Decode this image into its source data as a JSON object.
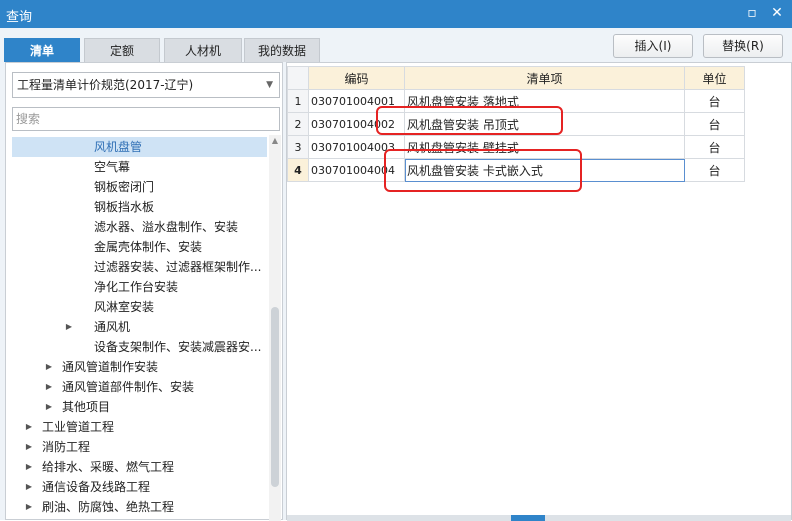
{
  "window": {
    "title": "查询",
    "restore_icon": "window-restore-icon",
    "close_icon": "close-icon"
  },
  "tabs": [
    {
      "label": "清单",
      "active": true
    },
    {
      "label": "定额",
      "active": false
    },
    {
      "label": "人材机",
      "active": false
    },
    {
      "label": "我的数据",
      "active": false
    }
  ],
  "buttons": {
    "insert": "插入(I)",
    "replace": "替换(R)"
  },
  "left": {
    "spec_select": "工程量清单计价规范(2017-辽宁)",
    "search_placeholder": "搜索",
    "tree": [
      {
        "label": "风机盘管",
        "selected": true,
        "expandable": false,
        "level": 3
      },
      {
        "label": "空气幕",
        "selected": false,
        "expandable": false,
        "level": 3
      },
      {
        "label": "钢板密闭门",
        "selected": false,
        "expandable": false,
        "level": 3
      },
      {
        "label": "钢板挡水板",
        "selected": false,
        "expandable": false,
        "level": 3
      },
      {
        "label": "滤水器、溢水盘制作、安装",
        "selected": false,
        "expandable": false,
        "level": 3
      },
      {
        "label": "金属壳体制作、安装",
        "selected": false,
        "expandable": false,
        "level": 3
      },
      {
        "label": "过滤器安装、过滤器框架制作...",
        "selected": false,
        "expandable": false,
        "level": 3
      },
      {
        "label": "净化工作台安装",
        "selected": false,
        "expandable": false,
        "level": 3
      },
      {
        "label": "风淋室安装",
        "selected": false,
        "expandable": false,
        "level": 3
      },
      {
        "label": "通风机",
        "selected": false,
        "expandable": true,
        "level": 3
      },
      {
        "label": "设备支架制作、安装减震器安...",
        "selected": false,
        "expandable": false,
        "level": 3
      },
      {
        "label": "通风管道制作安装",
        "selected": false,
        "expandable": true,
        "level": 2
      },
      {
        "label": "通风管道部件制作、安装",
        "selected": false,
        "expandable": true,
        "level": 2
      },
      {
        "label": "其他项目",
        "selected": false,
        "expandable": true,
        "level": 2
      },
      {
        "label": "工业管道工程",
        "selected": false,
        "expandable": true,
        "level": 1
      },
      {
        "label": "消防工程",
        "selected": false,
        "expandable": true,
        "level": 1
      },
      {
        "label": "给排水、采暖、燃气工程",
        "selected": false,
        "expandable": true,
        "level": 1
      },
      {
        "label": "通信设备及线路工程",
        "selected": false,
        "expandable": true,
        "level": 1
      },
      {
        "label": "刷油、防腐蚀、绝热工程",
        "selected": false,
        "expandable": true,
        "level": 1
      }
    ]
  },
  "grid": {
    "headers": [
      "编码",
      "清单项",
      "单位"
    ],
    "rows": [
      {
        "num": "1",
        "code": "030701004001",
        "name": "风机盘管安装  落地式",
        "unit": "台"
      },
      {
        "num": "2",
        "code": "030701004002",
        "name": "风机盘管安装  吊顶式",
        "unit": "台"
      },
      {
        "num": "3",
        "code": "030701004003",
        "name": "风机盘管安装  壁挂式",
        "unit": "台"
      },
      {
        "num": "4",
        "code": "030701004004",
        "name": "风机盘管安装  卡式嵌入式",
        "unit": "台"
      }
    ],
    "current_row": 4
  },
  "colors": {
    "accent": "#2f84c9",
    "highlight": "#e52323",
    "header_bg": "#fbf1da"
  }
}
